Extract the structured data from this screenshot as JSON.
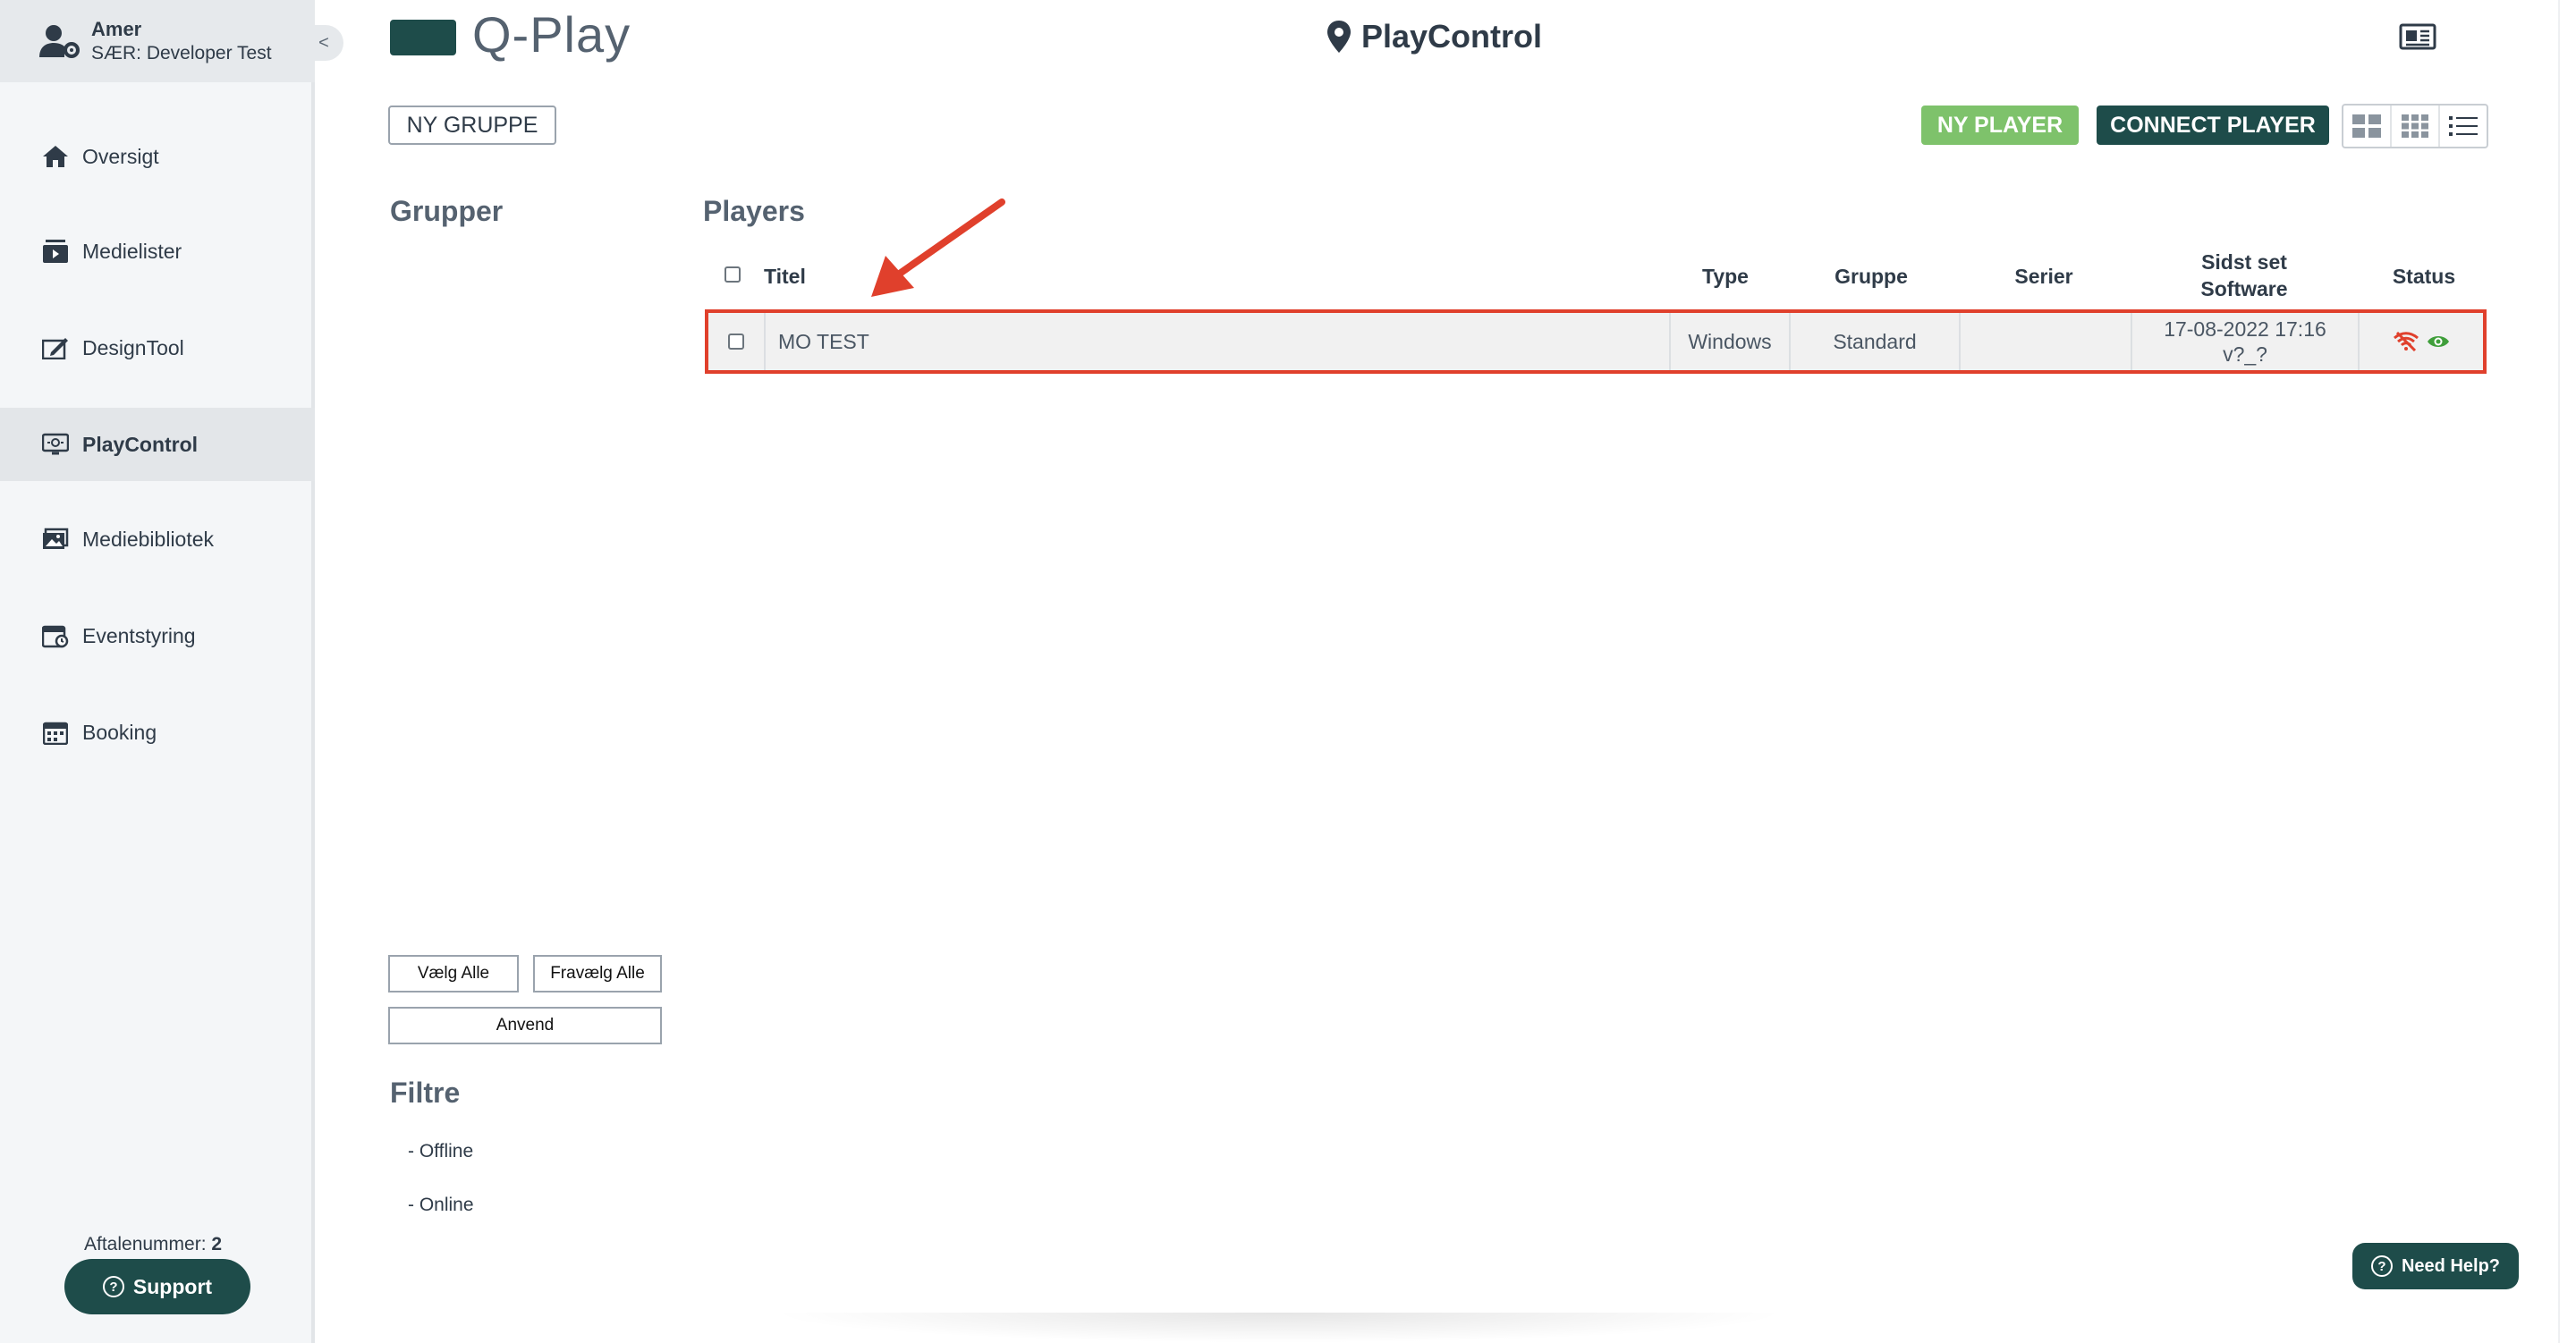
{
  "user": {
    "name": "Amer",
    "subtitle": "SÆR: Developer Test"
  },
  "sidebar": {
    "collapse_label": "<",
    "items": [
      {
        "label": "Oversigt",
        "icon": "home-icon"
      },
      {
        "label": "Medielister",
        "icon": "media-list-icon"
      },
      {
        "label": "DesignTool",
        "icon": "design-tool-icon"
      },
      {
        "label": "PlayControl",
        "icon": "play-control-icon",
        "active": true
      },
      {
        "label": "Mediebibliotek",
        "icon": "media-library-icon"
      },
      {
        "label": "Eventstyring",
        "icon": "event-calendar-icon"
      },
      {
        "label": "Booking",
        "icon": "booking-calendar-icon"
      }
    ],
    "agreement_label": "Aftalenummer:",
    "agreement_number": "2",
    "support_label": "Support"
  },
  "header": {
    "logo_text": "Q-Play",
    "page_title": "PlayControl"
  },
  "toolbar": {
    "new_group": "NY GRUPPE",
    "new_player": "NY PLAYER",
    "connect_player": "CONNECT PLAYER"
  },
  "groups": {
    "heading": "Grupper",
    "select_all": "Vælg Alle",
    "deselect_all": "Fravælg Alle",
    "apply": "Anvend"
  },
  "filters": {
    "heading": "Filtre",
    "items": [
      "- Offline",
      "- Online"
    ]
  },
  "players": {
    "heading": "Players",
    "columns": {
      "title": "Titel",
      "type": "Type",
      "group": "Gruppe",
      "series": "Serier",
      "last_seen": "Sidst set",
      "software": "Software",
      "status": "Status"
    },
    "rows": [
      {
        "title": "MO TEST",
        "type": "Windows",
        "group": "Standard",
        "series": "",
        "last_seen": "17-08-2022 17:16",
        "software": "v?_?",
        "status_icons": [
          "wifi-off-icon",
          "eye-icon"
        ]
      }
    ]
  },
  "help": {
    "label": "Need Help?"
  },
  "colors": {
    "brand": "#1e4c4a",
    "new_player": "#7ec26b",
    "highlight": "#e0402c"
  }
}
